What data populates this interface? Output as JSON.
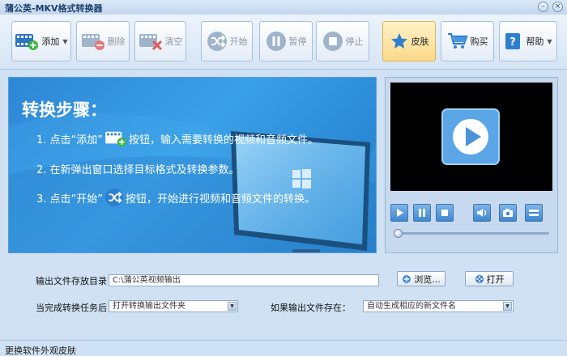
{
  "window": {
    "title": "蒲公英-MKV格式转换器",
    "min_icon": "minimize-icon",
    "close_icon": "close-icon"
  },
  "toolbar": {
    "add": "添加",
    "delete": "删除",
    "clear": "清空",
    "start": "开始",
    "pause": "暂停",
    "stop": "停止",
    "skin": "皮肤",
    "buy": "购买",
    "help": "帮助"
  },
  "guide": {
    "title": "转换步骤：",
    "step1_a": "1. 点击“添加”",
    "step1_b": "按钮，输入需要转换的视频和音频文件。",
    "step2": "2. 在新弹出窗口选择目标格式及转换参数。",
    "step3_a": "3. 点击“开始”",
    "step3_b": "按钮，开始进行视频和音频文件的转换。"
  },
  "player": {
    "controls": [
      "play-icon",
      "pause-icon",
      "stop-icon",
      "volume-icon",
      "snapshot-icon",
      "fullscreen-icon"
    ]
  },
  "settings": {
    "output_dir_label": "输出文件存放目录：",
    "output_dir_value": "C:\\蒲公英视频输出",
    "browse_label": "浏览...",
    "open_label": "打开",
    "after_done_label": "当完成转换任务后：",
    "after_done_value": "打开转换输出文件夹",
    "if_exists_label": "如果输出文件存在：",
    "if_exists_value": "自动生成相应的新文件名"
  },
  "status": {
    "change_skin": "更换软件外观皮肤"
  },
  "colors": {
    "accent": "#3aa0e8",
    "toolbar_bg": "#e3ecf7",
    "active_button": "#fbd98a",
    "window_bg": "#cfe1f3"
  }
}
